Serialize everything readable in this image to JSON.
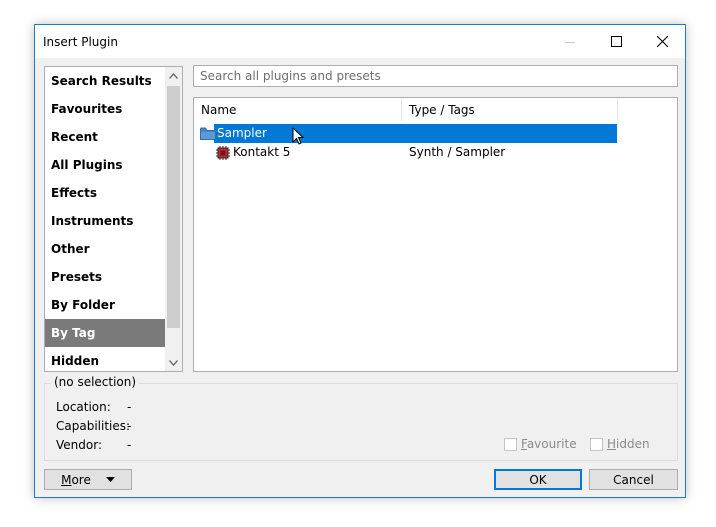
{
  "window": {
    "title": "Insert Plugin"
  },
  "sidebar": {
    "items": [
      {
        "label": "Search Results",
        "selected": false
      },
      {
        "label": "Favourites",
        "selected": false
      },
      {
        "label": "Recent",
        "selected": false
      },
      {
        "label": "All Plugins",
        "selected": false
      },
      {
        "label": "Effects",
        "selected": false
      },
      {
        "label": "Instruments",
        "selected": false
      },
      {
        "label": "Other",
        "selected": false
      },
      {
        "label": "Presets",
        "selected": false
      },
      {
        "label": "By Folder",
        "selected": false
      },
      {
        "label": "By Tag",
        "selected": true
      },
      {
        "label": "Hidden",
        "selected": false
      }
    ]
  },
  "search": {
    "placeholder": "Search all plugins and presets",
    "value": ""
  },
  "tree": {
    "columns": [
      "Name",
      "Type / Tags"
    ],
    "rows": [
      {
        "name": "Sampler",
        "type": "",
        "icon": "folder-icon",
        "selected": true
      },
      {
        "name": "Kontakt 5",
        "type": "Synth / Sampler",
        "icon": "plugin-chip-icon",
        "selected": false
      }
    ]
  },
  "info": {
    "title": "(no selection)",
    "location_label": "Location:",
    "location_value": "-",
    "capabilities_label": "Capabilities:",
    "capabilities_value": "-",
    "vendor_label": "Vendor:",
    "vendor_value": "-",
    "favourite_label": "Favourite",
    "favourite_accel": "F",
    "favourite_rest": "avourite",
    "hidden_label": "Hidden",
    "hidden_accel": "H",
    "hidden_rest": "idden"
  },
  "buttons": {
    "more_accel": "M",
    "more_rest": "ore",
    "ok": "OK",
    "cancel": "Cancel"
  },
  "colors": {
    "selection": "#0078d7",
    "accent_border": "#1979ca",
    "sidebar_selected": "#7a7a7a"
  }
}
